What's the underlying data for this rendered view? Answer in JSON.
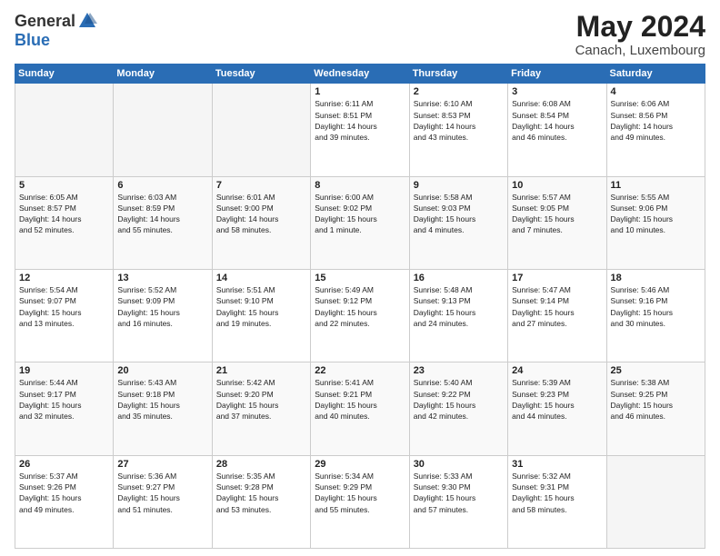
{
  "header": {
    "logo_general": "General",
    "logo_blue": "Blue",
    "month_title": "May 2024",
    "location": "Canach, Luxembourg"
  },
  "weekdays": [
    "Sunday",
    "Monday",
    "Tuesday",
    "Wednesday",
    "Thursday",
    "Friday",
    "Saturday"
  ],
  "weeks": [
    [
      {
        "day": "",
        "info": ""
      },
      {
        "day": "",
        "info": ""
      },
      {
        "day": "",
        "info": ""
      },
      {
        "day": "1",
        "info": "Sunrise: 6:11 AM\nSunset: 8:51 PM\nDaylight: 14 hours\nand 39 minutes."
      },
      {
        "day": "2",
        "info": "Sunrise: 6:10 AM\nSunset: 8:53 PM\nDaylight: 14 hours\nand 43 minutes."
      },
      {
        "day": "3",
        "info": "Sunrise: 6:08 AM\nSunset: 8:54 PM\nDaylight: 14 hours\nand 46 minutes."
      },
      {
        "day": "4",
        "info": "Sunrise: 6:06 AM\nSunset: 8:56 PM\nDaylight: 14 hours\nand 49 minutes."
      }
    ],
    [
      {
        "day": "5",
        "info": "Sunrise: 6:05 AM\nSunset: 8:57 PM\nDaylight: 14 hours\nand 52 minutes."
      },
      {
        "day": "6",
        "info": "Sunrise: 6:03 AM\nSunset: 8:59 PM\nDaylight: 14 hours\nand 55 minutes."
      },
      {
        "day": "7",
        "info": "Sunrise: 6:01 AM\nSunset: 9:00 PM\nDaylight: 14 hours\nand 58 minutes."
      },
      {
        "day": "8",
        "info": "Sunrise: 6:00 AM\nSunset: 9:02 PM\nDaylight: 15 hours\nand 1 minute."
      },
      {
        "day": "9",
        "info": "Sunrise: 5:58 AM\nSunset: 9:03 PM\nDaylight: 15 hours\nand 4 minutes."
      },
      {
        "day": "10",
        "info": "Sunrise: 5:57 AM\nSunset: 9:05 PM\nDaylight: 15 hours\nand 7 minutes."
      },
      {
        "day": "11",
        "info": "Sunrise: 5:55 AM\nSunset: 9:06 PM\nDaylight: 15 hours\nand 10 minutes."
      }
    ],
    [
      {
        "day": "12",
        "info": "Sunrise: 5:54 AM\nSunset: 9:07 PM\nDaylight: 15 hours\nand 13 minutes."
      },
      {
        "day": "13",
        "info": "Sunrise: 5:52 AM\nSunset: 9:09 PM\nDaylight: 15 hours\nand 16 minutes."
      },
      {
        "day": "14",
        "info": "Sunrise: 5:51 AM\nSunset: 9:10 PM\nDaylight: 15 hours\nand 19 minutes."
      },
      {
        "day": "15",
        "info": "Sunrise: 5:49 AM\nSunset: 9:12 PM\nDaylight: 15 hours\nand 22 minutes."
      },
      {
        "day": "16",
        "info": "Sunrise: 5:48 AM\nSunset: 9:13 PM\nDaylight: 15 hours\nand 24 minutes."
      },
      {
        "day": "17",
        "info": "Sunrise: 5:47 AM\nSunset: 9:14 PM\nDaylight: 15 hours\nand 27 minutes."
      },
      {
        "day": "18",
        "info": "Sunrise: 5:46 AM\nSunset: 9:16 PM\nDaylight: 15 hours\nand 30 minutes."
      }
    ],
    [
      {
        "day": "19",
        "info": "Sunrise: 5:44 AM\nSunset: 9:17 PM\nDaylight: 15 hours\nand 32 minutes."
      },
      {
        "day": "20",
        "info": "Sunrise: 5:43 AM\nSunset: 9:18 PM\nDaylight: 15 hours\nand 35 minutes."
      },
      {
        "day": "21",
        "info": "Sunrise: 5:42 AM\nSunset: 9:20 PM\nDaylight: 15 hours\nand 37 minutes."
      },
      {
        "day": "22",
        "info": "Sunrise: 5:41 AM\nSunset: 9:21 PM\nDaylight: 15 hours\nand 40 minutes."
      },
      {
        "day": "23",
        "info": "Sunrise: 5:40 AM\nSunset: 9:22 PM\nDaylight: 15 hours\nand 42 minutes."
      },
      {
        "day": "24",
        "info": "Sunrise: 5:39 AM\nSunset: 9:23 PM\nDaylight: 15 hours\nand 44 minutes."
      },
      {
        "day": "25",
        "info": "Sunrise: 5:38 AM\nSunset: 9:25 PM\nDaylight: 15 hours\nand 46 minutes."
      }
    ],
    [
      {
        "day": "26",
        "info": "Sunrise: 5:37 AM\nSunset: 9:26 PM\nDaylight: 15 hours\nand 49 minutes."
      },
      {
        "day": "27",
        "info": "Sunrise: 5:36 AM\nSunset: 9:27 PM\nDaylight: 15 hours\nand 51 minutes."
      },
      {
        "day": "28",
        "info": "Sunrise: 5:35 AM\nSunset: 9:28 PM\nDaylight: 15 hours\nand 53 minutes."
      },
      {
        "day": "29",
        "info": "Sunrise: 5:34 AM\nSunset: 9:29 PM\nDaylight: 15 hours\nand 55 minutes."
      },
      {
        "day": "30",
        "info": "Sunrise: 5:33 AM\nSunset: 9:30 PM\nDaylight: 15 hours\nand 57 minutes."
      },
      {
        "day": "31",
        "info": "Sunrise: 5:32 AM\nSunset: 9:31 PM\nDaylight: 15 hours\nand 58 minutes."
      },
      {
        "day": "",
        "info": ""
      }
    ]
  ]
}
